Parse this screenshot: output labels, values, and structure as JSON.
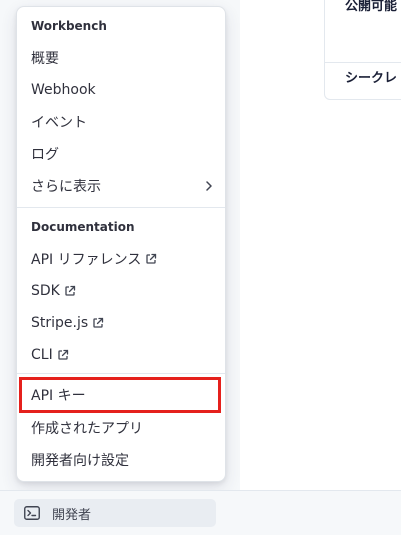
{
  "background": {
    "card_line1": "公開可能",
    "card_line2": "シークレ"
  },
  "menu": {
    "workbench_title": "Workbench",
    "workbench_items": [
      {
        "label": "概要"
      },
      {
        "label": "Webhook"
      },
      {
        "label": "イベント"
      },
      {
        "label": "ログ"
      },
      {
        "label": "さらに表示"
      }
    ],
    "documentation_title": "Documentation",
    "documentation_items": [
      {
        "label": "API リファレンス",
        "external": true
      },
      {
        "label": "SDK",
        "external": true
      },
      {
        "label": "Stripe.js",
        "external": true
      },
      {
        "label": "CLI",
        "external": true
      }
    ],
    "settings_items": [
      {
        "label": "API キー"
      },
      {
        "label": "作成されたアプリ"
      },
      {
        "label": "開発者向け設定"
      }
    ]
  },
  "bottom_bar": {
    "developer_label": "開発者"
  },
  "colors": {
    "highlight": "#e5201c",
    "text": "#30313d"
  }
}
